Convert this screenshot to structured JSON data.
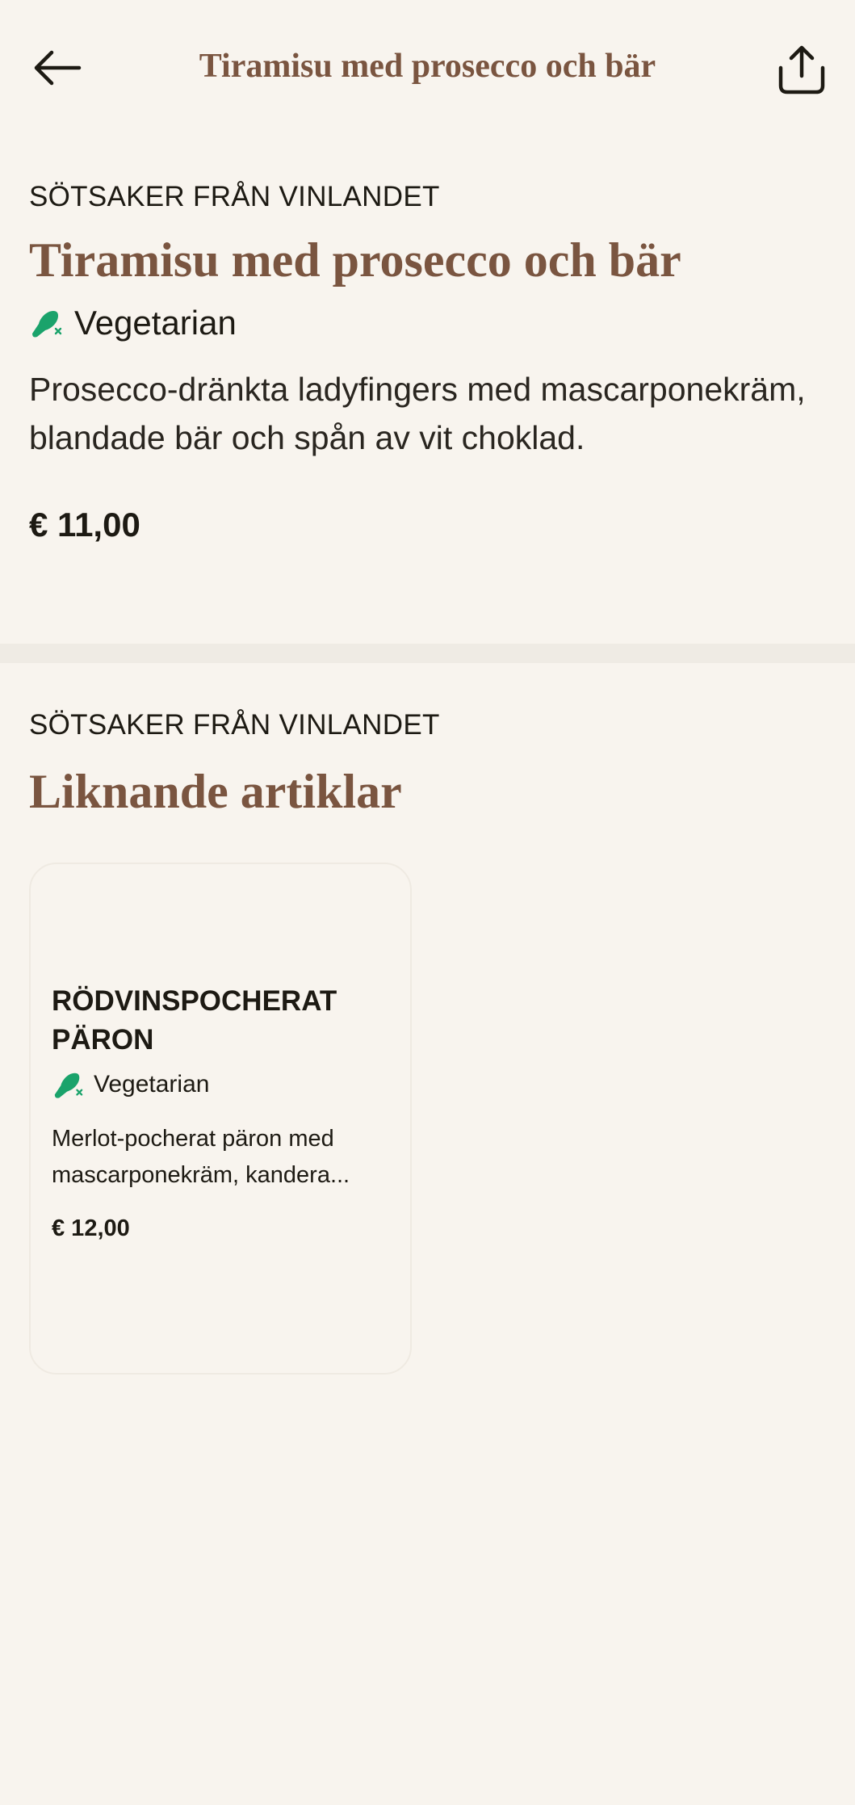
{
  "header": {
    "back_icon": "arrow-left-icon",
    "title": "Tiramisu med prosecco och bär",
    "share_icon": "share-icon"
  },
  "product": {
    "category": "SÖTSAKER FRÅN VINLANDET",
    "name": "Tiramisu med prosecco och bär",
    "tag_icon": "vegetarian-icon",
    "tag": "Vegetarian",
    "description": "Prosecco-dränkta ladyfingers med mascarponekräm, blandade bär och spån av vit choklad.",
    "price": "€ 11,00"
  },
  "similar": {
    "category": "SÖTSAKER FRÅN VINLANDET",
    "title": "Liknande artiklar",
    "items": [
      {
        "name": "RÖDVINSPOCHERAT PÄRON",
        "tag": "Vegetarian",
        "description": "Merlot-pocherat päron med mascarponekräm, kandera...",
        "price": "€ 12,00"
      }
    ]
  },
  "colors": {
    "background": "#f8f4ee",
    "accent_brown": "#7a5540",
    "vegetarian_green": "#1aa36b",
    "text": "#1d1a13"
  }
}
